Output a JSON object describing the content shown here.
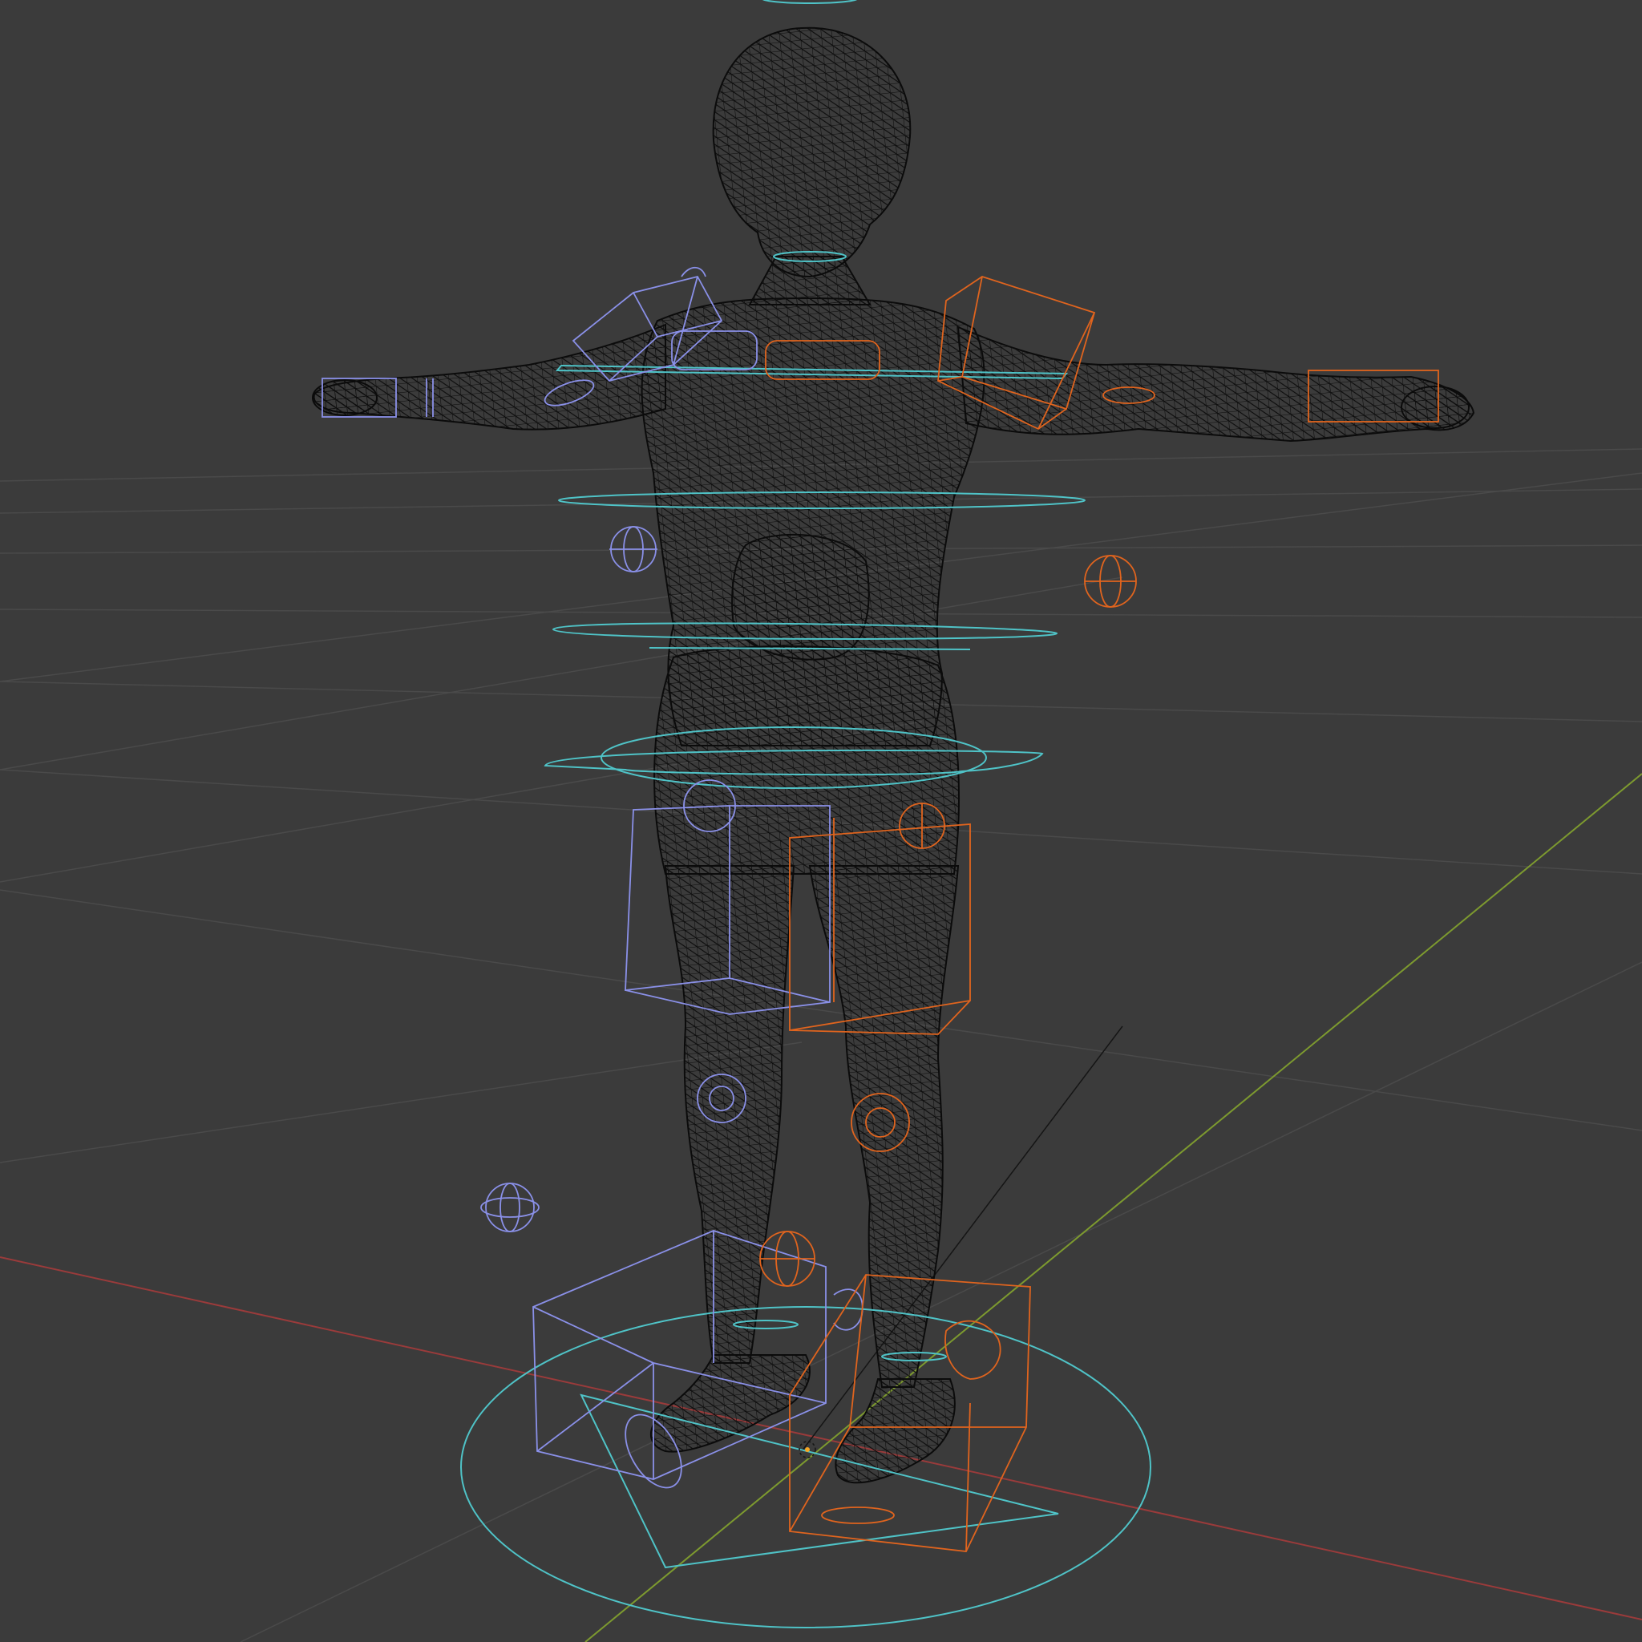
{
  "viewport": {
    "mode": "wireframe",
    "view": "perspective",
    "background_color": "#3b3b3b",
    "grid_color": "#4a4a4a",
    "x_axis_color": "#9a3b3b",
    "y_axis_color": "#7d9a2f",
    "mesh_color": "#0d0d0d"
  },
  "scene": {
    "object": "human-figure-mesh",
    "pose": "T-pose",
    "rig": {
      "left_controls_color": "#8a90e8",
      "right_controls_color": "#e0641e",
      "center_controls_color": "#4fc3c7",
      "icons": [
        "box-control-icon",
        "sphere-pole-icon",
        "ring-control-icon",
        "root-circle-icon",
        "origin-cursor-icon"
      ]
    }
  }
}
